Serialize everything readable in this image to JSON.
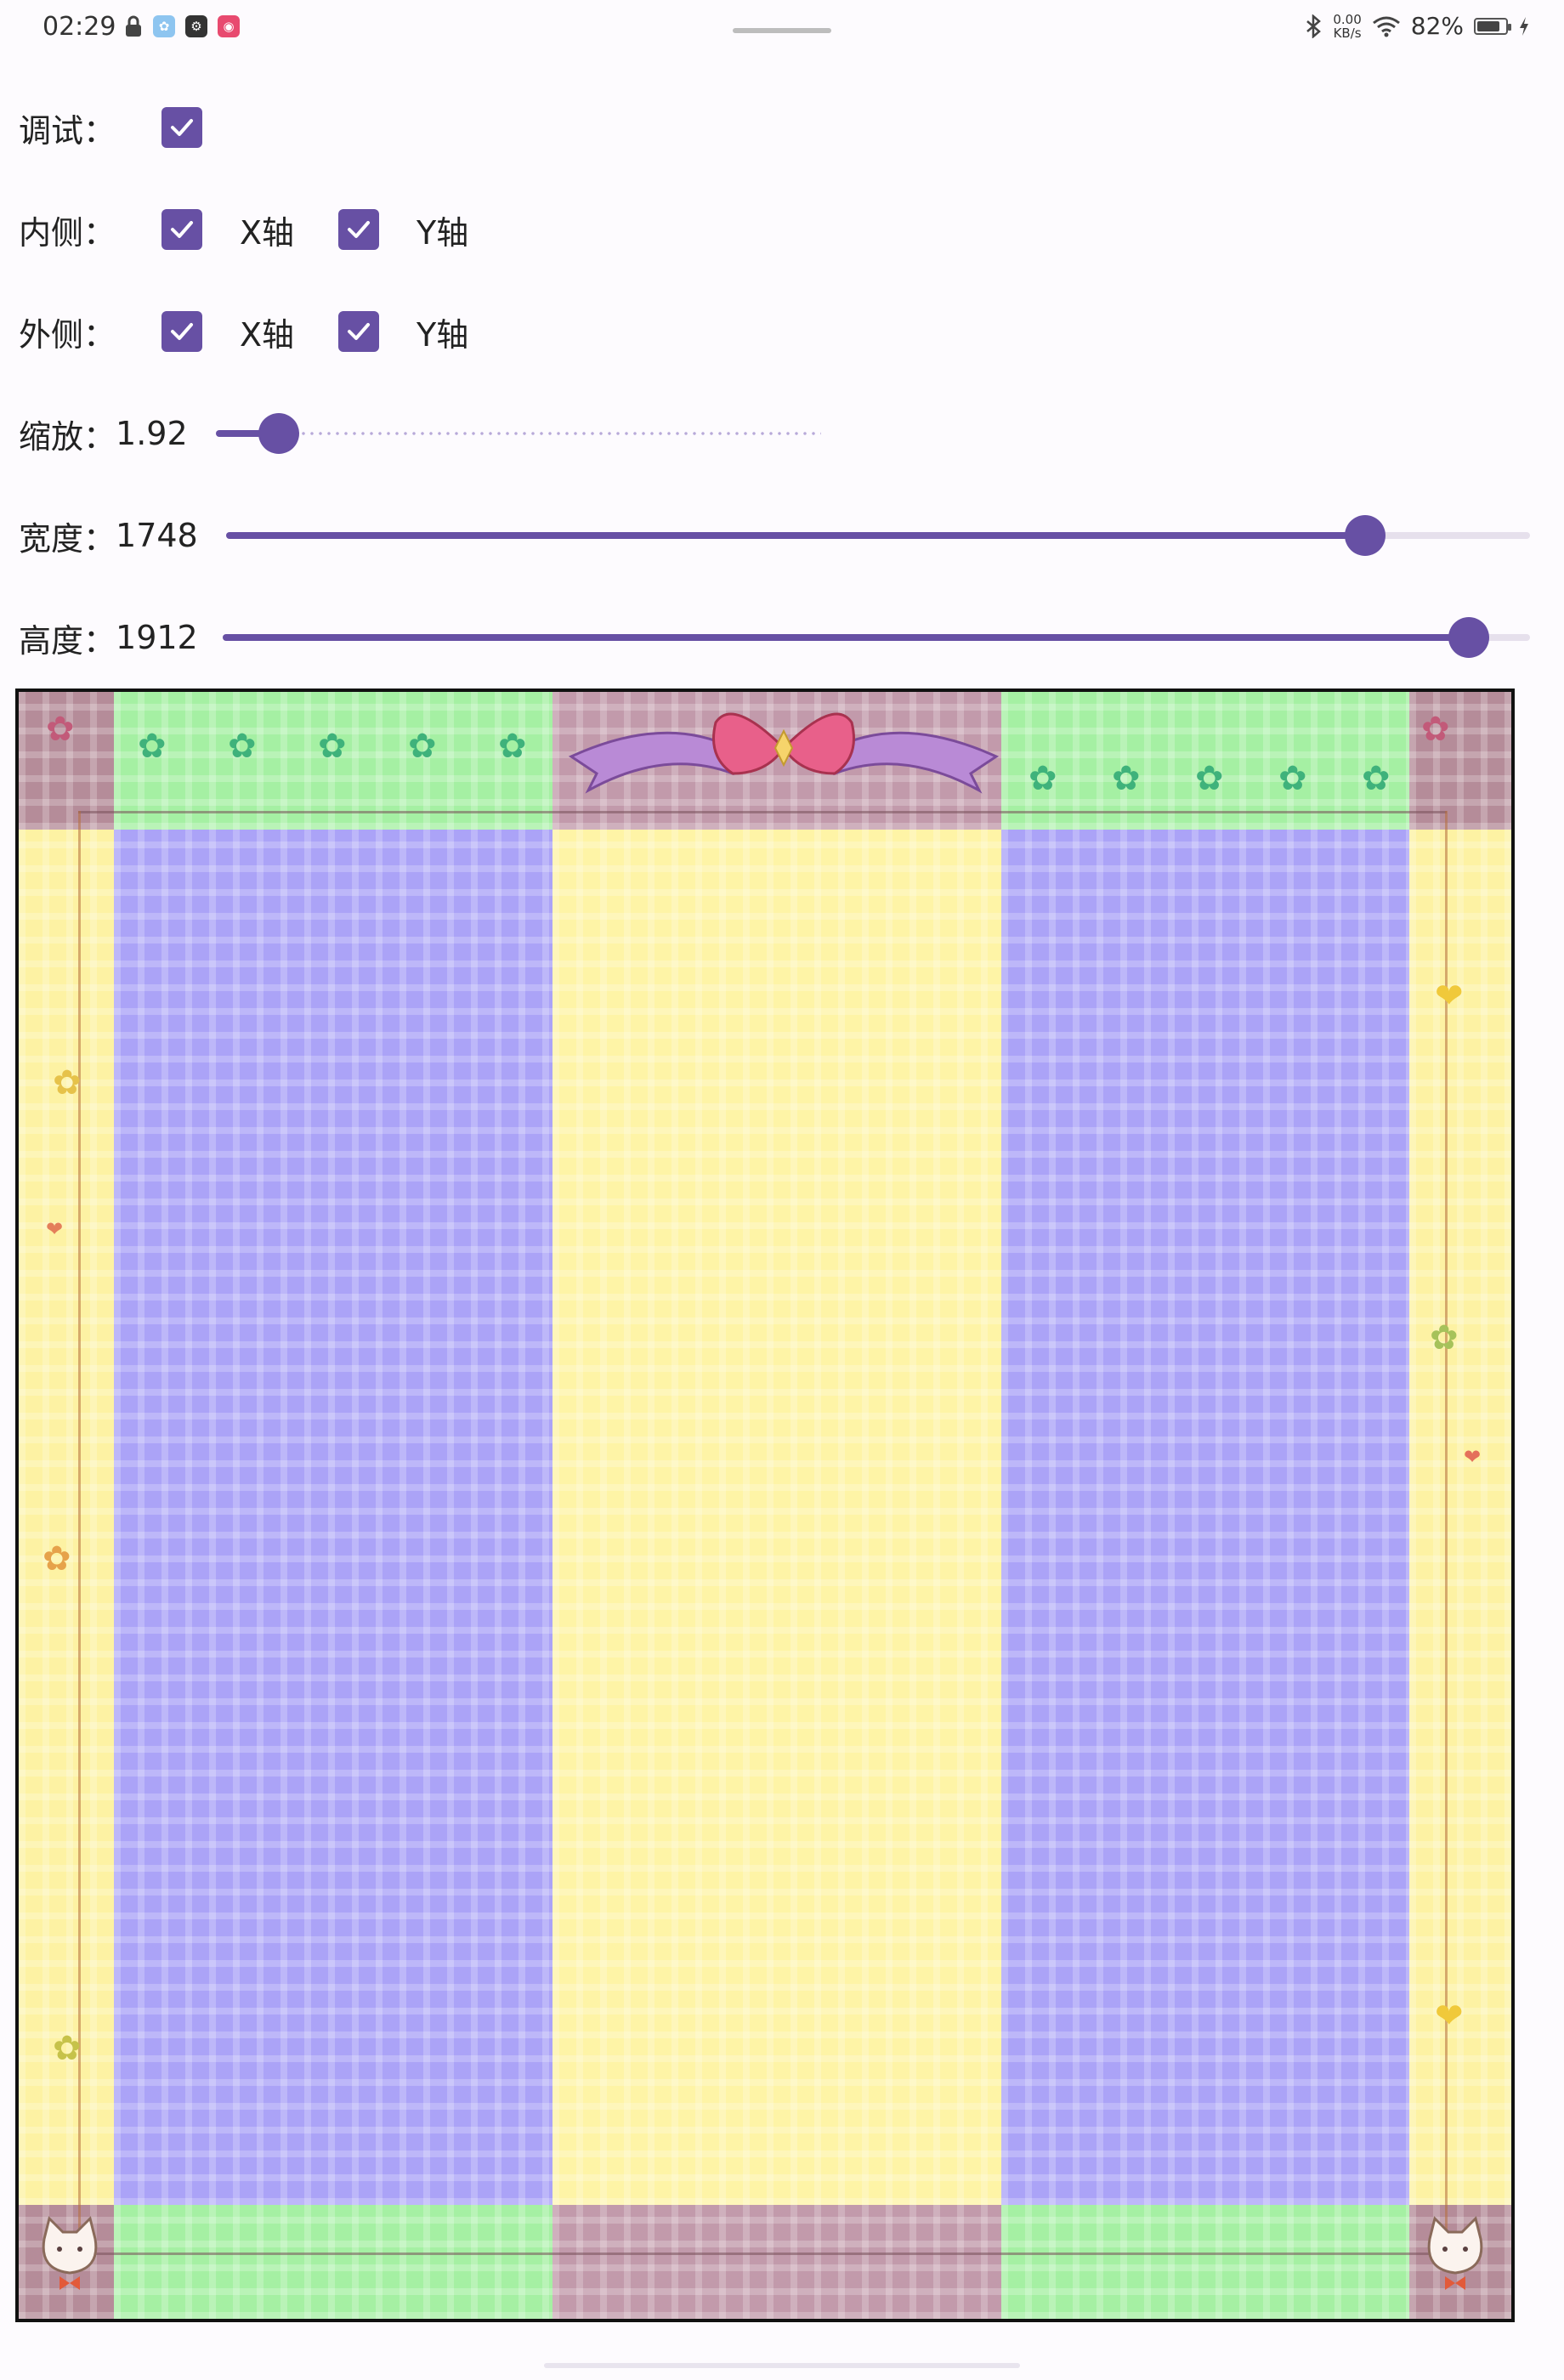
{
  "status_bar": {
    "time": "02:29",
    "net_speed_value": "0.00",
    "net_speed_unit": "KB/s",
    "battery_percent": "82%",
    "battery_level": 0.82
  },
  "controls": {
    "debug": {
      "label": "调试：",
      "checked": true
    },
    "inner": {
      "label": "内侧：",
      "x_label": "X轴",
      "x_checked": true,
      "y_label": "Y轴",
      "y_checked": true
    },
    "outer": {
      "label": "外侧：",
      "x_label": "X轴",
      "x_checked": true,
      "y_label": "Y轴",
      "y_checked": true
    },
    "scale": {
      "label": "缩放：",
      "value": "1.92"
    },
    "width": {
      "label": "宽度：",
      "value": "1748"
    },
    "height": {
      "label": "高度：",
      "value": "1912"
    }
  },
  "preview": {
    "region_colors": {
      "corner": "#b58c99",
      "edge_horizontal": "#a5f0a3",
      "edge_vertical": "#fdf2a3",
      "center_column": "#fef4a6",
      "side_column": "#aba3f7",
      "center_top": "#c29aab"
    },
    "decorations": [
      "flower-icon",
      "bow-icon",
      "heart-icon",
      "cat-icon"
    ]
  },
  "theme": {
    "accent": "#6750a4",
    "inactive_track": "#e6e0ec"
  }
}
